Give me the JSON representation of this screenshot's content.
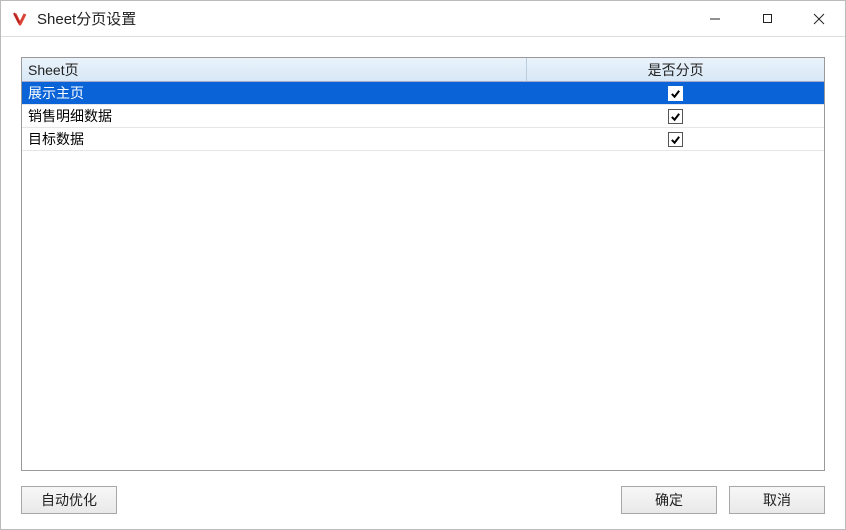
{
  "window": {
    "title": "Sheet分页设置"
  },
  "grid": {
    "columns": {
      "sheet": "Sheet页",
      "paging": "是否分页"
    },
    "rows": [
      {
        "name": "展示主页",
        "checked": true,
        "selected": true
      },
      {
        "name": "销售明细数据",
        "checked": true,
        "selected": false
      },
      {
        "name": "目标数据",
        "checked": true,
        "selected": false
      }
    ]
  },
  "buttons": {
    "auto_optimize": "自动优化",
    "ok": "确定",
    "cancel": "取消"
  }
}
